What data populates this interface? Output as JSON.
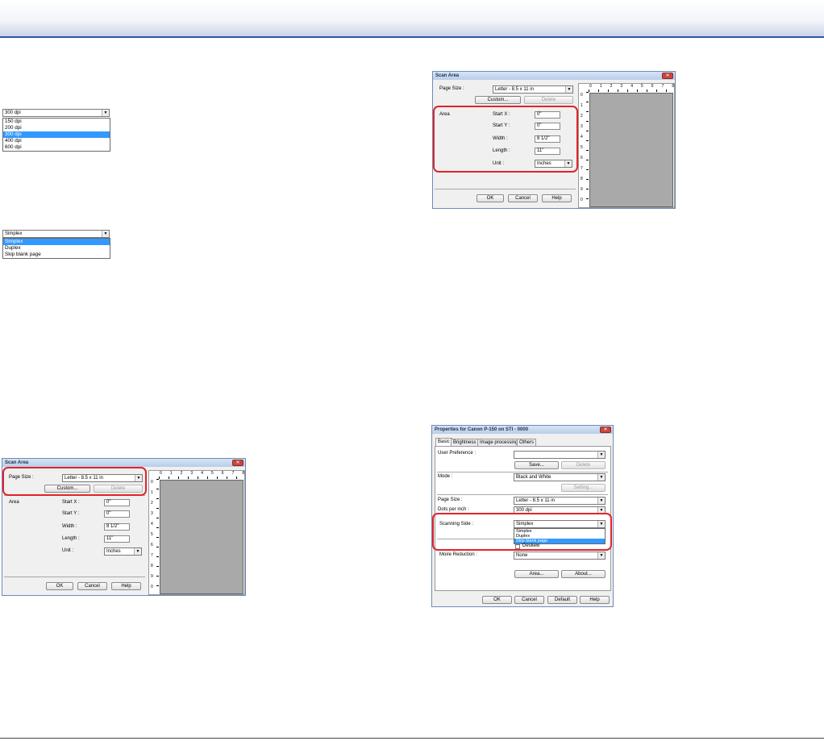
{
  "resolution_list": {
    "selected": "300 dpi",
    "options": [
      "150 dpi",
      "200 dpi",
      "300 dpi",
      "400 dpi",
      "600 dpi"
    ],
    "highlighted_index": 2
  },
  "scanning_side_list": {
    "selected": "Simplex",
    "options": [
      "Simplex",
      "Duplex",
      "Skip blank page"
    ],
    "highlighted_index": 0
  },
  "scan_area_dialog": {
    "title": "Scan Area",
    "page_size_label": "Page Size :",
    "page_size_value": "Letter - 8.5 x 11 in",
    "custom_button": "Custom...",
    "delete_button": "Delete",
    "area_label": "Area",
    "start_x_label": "Start X :",
    "start_x_value": "0\"",
    "start_y_label": "Start Y :",
    "start_y_value": "0\"",
    "width_label": "Width :",
    "width_value": "8 1/2\"",
    "length_label": "Length :",
    "length_value": "11\"",
    "unit_label": "Unit :",
    "unit_value": "Inches",
    "ok_button": "OK",
    "cancel_button": "Cancel",
    "help_button": "Help",
    "ruler_top": [
      "0",
      "1",
      "2",
      "3",
      "4",
      "5",
      "6",
      "7",
      "8"
    ],
    "ruler_left": [
      "0",
      "1",
      "2",
      "3",
      "4",
      "5",
      "6",
      "7",
      "8",
      "9",
      "0"
    ]
  },
  "properties_dialog": {
    "title": "Properties for Canon P-150 on STI - 0000",
    "tabs": [
      "Basic",
      "Brightness",
      "Image processing",
      "Others"
    ],
    "user_preference_label": "User Preference :",
    "user_preference_value": "",
    "save_button": "Save...",
    "delete_button": "Delete",
    "mode_label": "Mode :",
    "mode_value": "Black and White",
    "setting_button": "Setting...",
    "page_size_label": "Page Size :",
    "page_size_value": "Letter - 8.5 x 11 in",
    "dpi_label": "Dots per inch :",
    "dpi_value": "300 dpi",
    "scanning_side_label": "Scanning Side :",
    "scanning_side_value": "Simplex",
    "scanning_side_options": [
      "Simplex",
      "Duplex",
      "Skip blank page"
    ],
    "deskew_label": "Deskew",
    "moire_label": "Moire Reduction :",
    "moire_value": "None",
    "area_button": "Area...",
    "about_button": "About...",
    "ok_button": "OK",
    "cancel_button": "Cancel",
    "default_button": "Default",
    "help_button": "Help"
  },
  "colors": {
    "accent_rule": "#2d56a8",
    "highlight": "#e0242b",
    "selection": "#3399ff"
  }
}
